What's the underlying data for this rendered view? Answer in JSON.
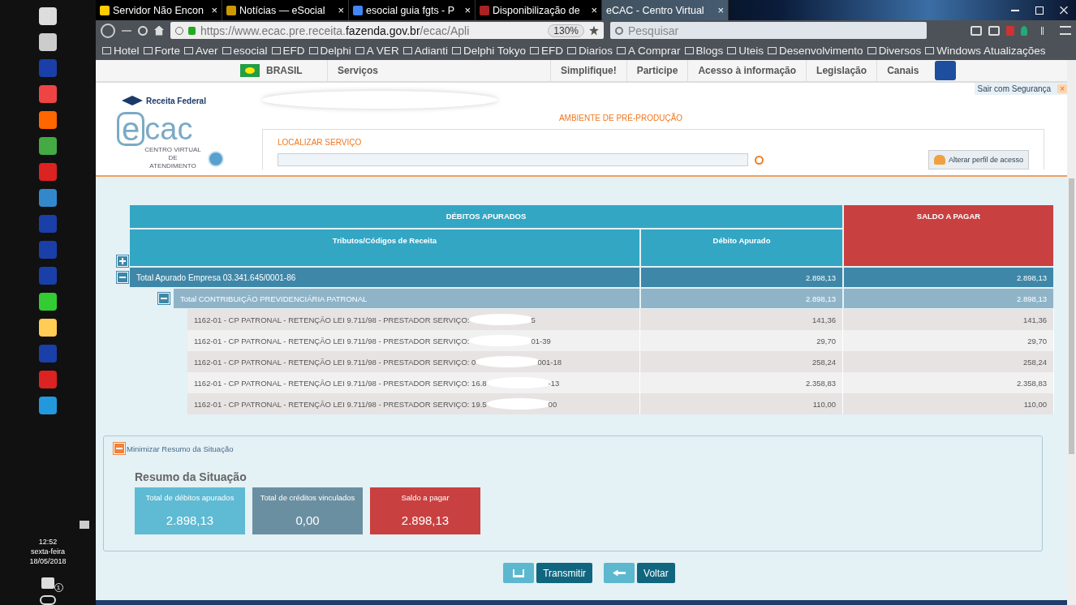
{
  "taskbar": {
    "time": "12:52",
    "day": "sexta-feira",
    "date": "18/05/2018",
    "notification_count": "1"
  },
  "browser": {
    "tabs": [
      {
        "title": "Servidor Não Encon",
        "selected": false,
        "close": "×"
      },
      {
        "title": "Notícias — eSocial",
        "selected": false,
        "close": "×"
      },
      {
        "title": "esocial guia fgts - P",
        "selected": false,
        "close": "×"
      },
      {
        "title": "Disponibilização de",
        "selected": false,
        "close": "×"
      },
      {
        "title": "eCAC - Centro Virtual",
        "selected": true,
        "close": "×"
      }
    ],
    "url": {
      "prefix": "https://www.ecac.pre.receita.",
      "domain": "fazenda.gov.br",
      "path": "/ecac/Apli"
    },
    "zoom": "130%",
    "search_placeholder": "Pesquisar",
    "bookmarks": [
      "Hotel",
      "Forte",
      "Aver",
      "esocial",
      "EFD",
      "Delphi",
      "A VER",
      "Adianti",
      "Delphi Tokyo",
      "EFD",
      "Diarios",
      "A Comprar",
      "Blogs",
      "Uteis",
      "Desenvolvimento",
      "Diversos",
      "Windows Atualizações"
    ]
  },
  "site_nav": {
    "country": "BRASIL",
    "items": [
      "Serviços",
      "Simplifique!",
      "Participe",
      "Acesso à informação",
      "Legislação",
      "Canais"
    ]
  },
  "header": {
    "org": "Receita Federal",
    "logo_letter": "e",
    "logo_text": "cac",
    "logo_subtitle": "CENTRO VIRTUAL DE ATENDIMENTO",
    "environment": "AMBIENTE DE PRÉ-PRODUÇÃO",
    "search_label": "LOCALIZAR SERVIÇO",
    "logout": "Sair com Segurança",
    "logout_close": "×",
    "profile_button": "Alterar perfil de acesso"
  },
  "table": {
    "group_header": "DÉBITOS APURADOS",
    "balance_header": "SALDO A PAGAR",
    "columns": [
      "Tributos/Códigos de Receita",
      "Débito Apurado"
    ],
    "total": {
      "label": "Total Apurado Empresa 03.341.645/0001-86",
      "debit": "2.898,13",
      "balance": "2.898,13",
      "expanded": true
    },
    "subtotal": {
      "label": "Total CONTRIBUIÇÃO PREVIDENCIÁRIA PATRONAL",
      "debit": "2.898,13",
      "balance": "2.898,13",
      "expanded": true
    },
    "rows": [
      {
        "description": "1162-01 - CP PATRONAL - RETENÇÃO LEI 9.711/98 - PRESTADOR SERVIÇO:",
        "tail": "5",
        "debit": "141,36",
        "balance": "141,36"
      },
      {
        "description": "1162-01 - CP PATRONAL - RETENÇÃO LEI 9.711/98 - PRESTADOR SERVIÇO:",
        "tail": "01-39",
        "debit": "29,70",
        "balance": "29,70"
      },
      {
        "description": "1162-01 - CP PATRONAL - RETENÇÃO LEI 9.711/98 - PRESTADOR SERVIÇO: 0",
        "tail": "001-18",
        "debit": "258,24",
        "balance": "258,24"
      },
      {
        "description": "1162-01 - CP PATRONAL - RETENÇÃO LEI 9.711/98 - PRESTADOR SERVIÇO: 16.8",
        "tail": "-13",
        "debit": "2.358,83",
        "balance": "2.358,83"
      },
      {
        "description": "1162-01 - CP PATRONAL - RETENÇÃO LEI 9.711/98 - PRESTADOR SERVIÇO: 19.5",
        "tail": "00",
        "debit": "110,00",
        "balance": "110,00"
      }
    ]
  },
  "summary": {
    "toggle": "Minimizar Resumo da Situação",
    "expanded": true,
    "title": "Resumo da Situação",
    "cards": [
      {
        "label": "Total de débitos apurados",
        "value": "2.898,13",
        "color": "#5fbad3"
      },
      {
        "label": "Total de créditos vinculados",
        "value": "0,00",
        "color": "#6a8fa1"
      },
      {
        "label": "Saldo a pagar",
        "value": "2.898,13",
        "color": "#c94040"
      }
    ]
  },
  "buttons": [
    "Transmitir",
    "Voltar"
  ]
}
